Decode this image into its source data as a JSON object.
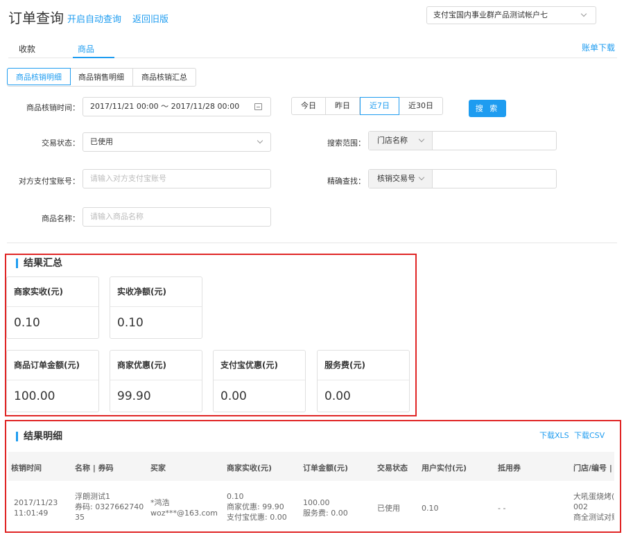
{
  "header": {
    "title": "订单查询",
    "auto_query": "开启自动查询",
    "back_old": "返回旧版",
    "account": "支付宝国内事业群产品测试帐户七"
  },
  "tabs": [
    {
      "label": "收款"
    },
    {
      "label": "商品"
    }
  ],
  "bill_download": "账单下载",
  "subtabs": [
    {
      "label": "商品核销明细"
    },
    {
      "label": "商品销售明细"
    },
    {
      "label": "商品核销汇总"
    }
  ],
  "form": {
    "time_label": "商品核销时间：",
    "time_value": "2017/11/21 00:00  ～  2017/11/28 00:00",
    "quick": [
      "今日",
      "昨日",
      "近7日",
      "近30日"
    ],
    "search_btn": "搜 索",
    "status_label": "交易状态：",
    "status_value": "已使用",
    "range_label": "搜索范围：",
    "range_value": "门店名称",
    "account_label": "对方支付宝账号：",
    "account_placeholder": "请输入对方支付宝账号",
    "exact_label": "精确查找：",
    "exact_value": "核销交易号",
    "product_label": "商品名称：",
    "product_placeholder": "请输入商品名称"
  },
  "summary": {
    "title": "结果汇总",
    "cards": [
      {
        "label": "商家实收(元)",
        "value": "0.10"
      },
      {
        "label": "实收净额(元)",
        "value": "0.10"
      },
      {
        "label": "商品订单金额(元)",
        "value": "100.00"
      },
      {
        "label": "商家优惠(元)",
        "value": "99.90"
      },
      {
        "label": "支付宝优惠(元)",
        "value": "0.00"
      },
      {
        "label": "服务费(元)",
        "value": "0.00"
      }
    ]
  },
  "detail": {
    "title": "结果明细",
    "download_xls": "下载XLS",
    "download_csv": "下载CSV",
    "columns": [
      "核销时间",
      "名称 | 券码",
      "买家",
      "商家实收(元)",
      "订单金额(元)",
      "交易状态",
      "用户实付(元)",
      "抵用券",
      "门店/编号 |"
    ],
    "row": {
      "time1": "2017/11/23",
      "time2": "11:01:49",
      "name": "浮朗测试1",
      "code1": "券码: 0327662740",
      "code2": "35",
      "buyer1": "*鸿浩",
      "buyer2": "woz***@163.com",
      "income1": "0.10",
      "income2": "商家优惠: 99.90",
      "income3": "支付宝优惠: 0.00",
      "order1": "100.00",
      "order2": "服务费: 0.00",
      "status": "已使用",
      "paid": "0.10",
      "coupon": "- -",
      "store1": "大吼蛋烧烤(试",
      "store2": "002",
      "store3": "商全测试对账"
    }
  }
}
